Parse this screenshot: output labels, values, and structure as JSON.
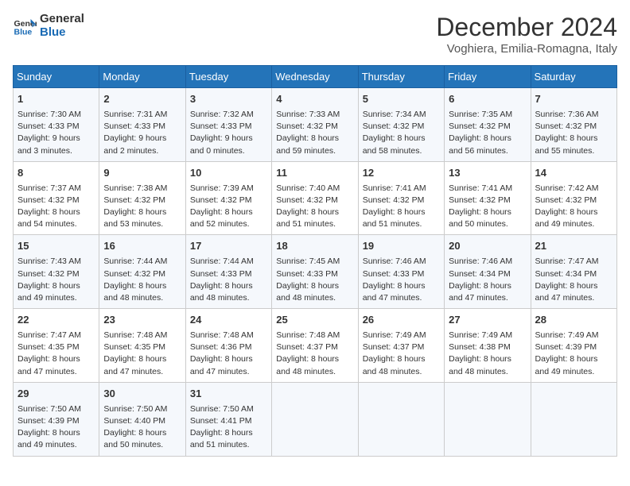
{
  "header": {
    "logo_line1": "General",
    "logo_line2": "Blue",
    "month_title": "December 2024",
    "location": "Voghiera, Emilia-Romagna, Italy"
  },
  "weekdays": [
    "Sunday",
    "Monday",
    "Tuesday",
    "Wednesday",
    "Thursday",
    "Friday",
    "Saturday"
  ],
  "weeks": [
    [
      {
        "day": "1",
        "lines": [
          "Sunrise: 7:30 AM",
          "Sunset: 4:33 PM",
          "Daylight: 9 hours",
          "and 3 minutes."
        ]
      },
      {
        "day": "2",
        "lines": [
          "Sunrise: 7:31 AM",
          "Sunset: 4:33 PM",
          "Daylight: 9 hours",
          "and 2 minutes."
        ]
      },
      {
        "day": "3",
        "lines": [
          "Sunrise: 7:32 AM",
          "Sunset: 4:33 PM",
          "Daylight: 9 hours",
          "and 0 minutes."
        ]
      },
      {
        "day": "4",
        "lines": [
          "Sunrise: 7:33 AM",
          "Sunset: 4:32 PM",
          "Daylight: 8 hours",
          "and 59 minutes."
        ]
      },
      {
        "day": "5",
        "lines": [
          "Sunrise: 7:34 AM",
          "Sunset: 4:32 PM",
          "Daylight: 8 hours",
          "and 58 minutes."
        ]
      },
      {
        "day": "6",
        "lines": [
          "Sunrise: 7:35 AM",
          "Sunset: 4:32 PM",
          "Daylight: 8 hours",
          "and 56 minutes."
        ]
      },
      {
        "day": "7",
        "lines": [
          "Sunrise: 7:36 AM",
          "Sunset: 4:32 PM",
          "Daylight: 8 hours",
          "and 55 minutes."
        ]
      }
    ],
    [
      {
        "day": "8",
        "lines": [
          "Sunrise: 7:37 AM",
          "Sunset: 4:32 PM",
          "Daylight: 8 hours",
          "and 54 minutes."
        ]
      },
      {
        "day": "9",
        "lines": [
          "Sunrise: 7:38 AM",
          "Sunset: 4:32 PM",
          "Daylight: 8 hours",
          "and 53 minutes."
        ]
      },
      {
        "day": "10",
        "lines": [
          "Sunrise: 7:39 AM",
          "Sunset: 4:32 PM",
          "Daylight: 8 hours",
          "and 52 minutes."
        ]
      },
      {
        "day": "11",
        "lines": [
          "Sunrise: 7:40 AM",
          "Sunset: 4:32 PM",
          "Daylight: 8 hours",
          "and 51 minutes."
        ]
      },
      {
        "day": "12",
        "lines": [
          "Sunrise: 7:41 AM",
          "Sunset: 4:32 PM",
          "Daylight: 8 hours",
          "and 51 minutes."
        ]
      },
      {
        "day": "13",
        "lines": [
          "Sunrise: 7:41 AM",
          "Sunset: 4:32 PM",
          "Daylight: 8 hours",
          "and 50 minutes."
        ]
      },
      {
        "day": "14",
        "lines": [
          "Sunrise: 7:42 AM",
          "Sunset: 4:32 PM",
          "Daylight: 8 hours",
          "and 49 minutes."
        ]
      }
    ],
    [
      {
        "day": "15",
        "lines": [
          "Sunrise: 7:43 AM",
          "Sunset: 4:32 PM",
          "Daylight: 8 hours",
          "and 49 minutes."
        ]
      },
      {
        "day": "16",
        "lines": [
          "Sunrise: 7:44 AM",
          "Sunset: 4:32 PM",
          "Daylight: 8 hours",
          "and 48 minutes."
        ]
      },
      {
        "day": "17",
        "lines": [
          "Sunrise: 7:44 AM",
          "Sunset: 4:33 PM",
          "Daylight: 8 hours",
          "and 48 minutes."
        ]
      },
      {
        "day": "18",
        "lines": [
          "Sunrise: 7:45 AM",
          "Sunset: 4:33 PM",
          "Daylight: 8 hours",
          "and 48 minutes."
        ]
      },
      {
        "day": "19",
        "lines": [
          "Sunrise: 7:46 AM",
          "Sunset: 4:33 PM",
          "Daylight: 8 hours",
          "and 47 minutes."
        ]
      },
      {
        "day": "20",
        "lines": [
          "Sunrise: 7:46 AM",
          "Sunset: 4:34 PM",
          "Daylight: 8 hours",
          "and 47 minutes."
        ]
      },
      {
        "day": "21",
        "lines": [
          "Sunrise: 7:47 AM",
          "Sunset: 4:34 PM",
          "Daylight: 8 hours",
          "and 47 minutes."
        ]
      }
    ],
    [
      {
        "day": "22",
        "lines": [
          "Sunrise: 7:47 AM",
          "Sunset: 4:35 PM",
          "Daylight: 8 hours",
          "and 47 minutes."
        ]
      },
      {
        "day": "23",
        "lines": [
          "Sunrise: 7:48 AM",
          "Sunset: 4:35 PM",
          "Daylight: 8 hours",
          "and 47 minutes."
        ]
      },
      {
        "day": "24",
        "lines": [
          "Sunrise: 7:48 AM",
          "Sunset: 4:36 PM",
          "Daylight: 8 hours",
          "and 47 minutes."
        ]
      },
      {
        "day": "25",
        "lines": [
          "Sunrise: 7:48 AM",
          "Sunset: 4:37 PM",
          "Daylight: 8 hours",
          "and 48 minutes."
        ]
      },
      {
        "day": "26",
        "lines": [
          "Sunrise: 7:49 AM",
          "Sunset: 4:37 PM",
          "Daylight: 8 hours",
          "and 48 minutes."
        ]
      },
      {
        "day": "27",
        "lines": [
          "Sunrise: 7:49 AM",
          "Sunset: 4:38 PM",
          "Daylight: 8 hours",
          "and 48 minutes."
        ]
      },
      {
        "day": "28",
        "lines": [
          "Sunrise: 7:49 AM",
          "Sunset: 4:39 PM",
          "Daylight: 8 hours",
          "and 49 minutes."
        ]
      }
    ],
    [
      {
        "day": "29",
        "lines": [
          "Sunrise: 7:50 AM",
          "Sunset: 4:39 PM",
          "Daylight: 8 hours",
          "and 49 minutes."
        ]
      },
      {
        "day": "30",
        "lines": [
          "Sunrise: 7:50 AM",
          "Sunset: 4:40 PM",
          "Daylight: 8 hours",
          "and 50 minutes."
        ]
      },
      {
        "day": "31",
        "lines": [
          "Sunrise: 7:50 AM",
          "Sunset: 4:41 PM",
          "Daylight: 8 hours",
          "and 51 minutes."
        ]
      },
      {
        "day": "",
        "lines": []
      },
      {
        "day": "",
        "lines": []
      },
      {
        "day": "",
        "lines": []
      },
      {
        "day": "",
        "lines": []
      }
    ]
  ]
}
